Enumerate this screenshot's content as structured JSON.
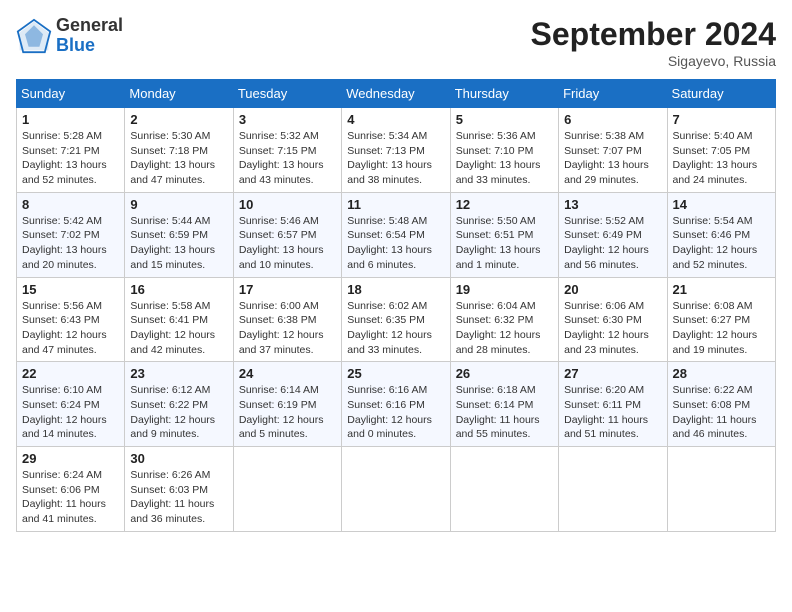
{
  "header": {
    "logo_general": "General",
    "logo_blue": "Blue",
    "month_year": "September 2024",
    "location": "Sigayevo, Russia"
  },
  "weekdays": [
    "Sunday",
    "Monday",
    "Tuesday",
    "Wednesday",
    "Thursday",
    "Friday",
    "Saturday"
  ],
  "weeks": [
    [
      {
        "day": "1",
        "sunrise": "Sunrise: 5:28 AM",
        "sunset": "Sunset: 7:21 PM",
        "daylight": "Daylight: 13 hours and 52 minutes."
      },
      {
        "day": "2",
        "sunrise": "Sunrise: 5:30 AM",
        "sunset": "Sunset: 7:18 PM",
        "daylight": "Daylight: 13 hours and 47 minutes."
      },
      {
        "day": "3",
        "sunrise": "Sunrise: 5:32 AM",
        "sunset": "Sunset: 7:15 PM",
        "daylight": "Daylight: 13 hours and 43 minutes."
      },
      {
        "day": "4",
        "sunrise": "Sunrise: 5:34 AM",
        "sunset": "Sunset: 7:13 PM",
        "daylight": "Daylight: 13 hours and 38 minutes."
      },
      {
        "day": "5",
        "sunrise": "Sunrise: 5:36 AM",
        "sunset": "Sunset: 7:10 PM",
        "daylight": "Daylight: 13 hours and 33 minutes."
      },
      {
        "day": "6",
        "sunrise": "Sunrise: 5:38 AM",
        "sunset": "Sunset: 7:07 PM",
        "daylight": "Daylight: 13 hours and 29 minutes."
      },
      {
        "day": "7",
        "sunrise": "Sunrise: 5:40 AM",
        "sunset": "Sunset: 7:05 PM",
        "daylight": "Daylight: 13 hours and 24 minutes."
      }
    ],
    [
      {
        "day": "8",
        "sunrise": "Sunrise: 5:42 AM",
        "sunset": "Sunset: 7:02 PM",
        "daylight": "Daylight: 13 hours and 20 minutes."
      },
      {
        "day": "9",
        "sunrise": "Sunrise: 5:44 AM",
        "sunset": "Sunset: 6:59 PM",
        "daylight": "Daylight: 13 hours and 15 minutes."
      },
      {
        "day": "10",
        "sunrise": "Sunrise: 5:46 AM",
        "sunset": "Sunset: 6:57 PM",
        "daylight": "Daylight: 13 hours and 10 minutes."
      },
      {
        "day": "11",
        "sunrise": "Sunrise: 5:48 AM",
        "sunset": "Sunset: 6:54 PM",
        "daylight": "Daylight: 13 hours and 6 minutes."
      },
      {
        "day": "12",
        "sunrise": "Sunrise: 5:50 AM",
        "sunset": "Sunset: 6:51 PM",
        "daylight": "Daylight: 13 hours and 1 minute."
      },
      {
        "day": "13",
        "sunrise": "Sunrise: 5:52 AM",
        "sunset": "Sunset: 6:49 PM",
        "daylight": "Daylight: 12 hours and 56 minutes."
      },
      {
        "day": "14",
        "sunrise": "Sunrise: 5:54 AM",
        "sunset": "Sunset: 6:46 PM",
        "daylight": "Daylight: 12 hours and 52 minutes."
      }
    ],
    [
      {
        "day": "15",
        "sunrise": "Sunrise: 5:56 AM",
        "sunset": "Sunset: 6:43 PM",
        "daylight": "Daylight: 12 hours and 47 minutes."
      },
      {
        "day": "16",
        "sunrise": "Sunrise: 5:58 AM",
        "sunset": "Sunset: 6:41 PM",
        "daylight": "Daylight: 12 hours and 42 minutes."
      },
      {
        "day": "17",
        "sunrise": "Sunrise: 6:00 AM",
        "sunset": "Sunset: 6:38 PM",
        "daylight": "Daylight: 12 hours and 37 minutes."
      },
      {
        "day": "18",
        "sunrise": "Sunrise: 6:02 AM",
        "sunset": "Sunset: 6:35 PM",
        "daylight": "Daylight: 12 hours and 33 minutes."
      },
      {
        "day": "19",
        "sunrise": "Sunrise: 6:04 AM",
        "sunset": "Sunset: 6:32 PM",
        "daylight": "Daylight: 12 hours and 28 minutes."
      },
      {
        "day": "20",
        "sunrise": "Sunrise: 6:06 AM",
        "sunset": "Sunset: 6:30 PM",
        "daylight": "Daylight: 12 hours and 23 minutes."
      },
      {
        "day": "21",
        "sunrise": "Sunrise: 6:08 AM",
        "sunset": "Sunset: 6:27 PM",
        "daylight": "Daylight: 12 hours and 19 minutes."
      }
    ],
    [
      {
        "day": "22",
        "sunrise": "Sunrise: 6:10 AM",
        "sunset": "Sunset: 6:24 PM",
        "daylight": "Daylight: 12 hours and 14 minutes."
      },
      {
        "day": "23",
        "sunrise": "Sunrise: 6:12 AM",
        "sunset": "Sunset: 6:22 PM",
        "daylight": "Daylight: 12 hours and 9 minutes."
      },
      {
        "day": "24",
        "sunrise": "Sunrise: 6:14 AM",
        "sunset": "Sunset: 6:19 PM",
        "daylight": "Daylight: 12 hours and 5 minutes."
      },
      {
        "day": "25",
        "sunrise": "Sunrise: 6:16 AM",
        "sunset": "Sunset: 6:16 PM",
        "daylight": "Daylight: 12 hours and 0 minutes."
      },
      {
        "day": "26",
        "sunrise": "Sunrise: 6:18 AM",
        "sunset": "Sunset: 6:14 PM",
        "daylight": "Daylight: 11 hours and 55 minutes."
      },
      {
        "day": "27",
        "sunrise": "Sunrise: 6:20 AM",
        "sunset": "Sunset: 6:11 PM",
        "daylight": "Daylight: 11 hours and 51 minutes."
      },
      {
        "day": "28",
        "sunrise": "Sunrise: 6:22 AM",
        "sunset": "Sunset: 6:08 PM",
        "daylight": "Daylight: 11 hours and 46 minutes."
      }
    ],
    [
      {
        "day": "29",
        "sunrise": "Sunrise: 6:24 AM",
        "sunset": "Sunset: 6:06 PM",
        "daylight": "Daylight: 11 hours and 41 minutes."
      },
      {
        "day": "30",
        "sunrise": "Sunrise: 6:26 AM",
        "sunset": "Sunset: 6:03 PM",
        "daylight": "Daylight: 11 hours and 36 minutes."
      },
      null,
      null,
      null,
      null,
      null
    ]
  ]
}
